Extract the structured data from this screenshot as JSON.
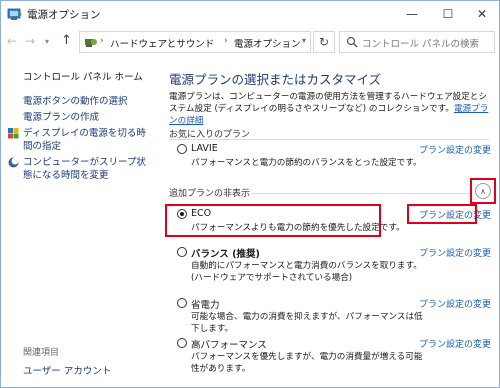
{
  "window": {
    "title": "電源オプション",
    "controls": {
      "minimize": "—",
      "maximize": "☐",
      "close": "✕"
    }
  },
  "nav": {
    "back": "←",
    "forward": "→",
    "dropdown": "▾",
    "up": "↑",
    "breadcrumb": [
      "ハードウェアとサウンド",
      "電源オプション"
    ],
    "separator": "›",
    "address_dropdown": "▾",
    "refresh": "↻",
    "search_placeholder": "コントロール パネルの検索"
  },
  "sidebar": {
    "home": "コントロール パネル ホーム",
    "links": [
      "電源ボタンの動作の選択",
      "電源プランの作成",
      "ディスプレイの電源を切る時間の指定",
      "コンピューターがスリープ状態になる時間を変更"
    ],
    "related_label": "関連項目",
    "user_accounts": "ユーザー アカウント"
  },
  "main": {
    "title": "電源プランの選択またはカスタマイズ",
    "description": "電源プランは、コンピューターの電源の使用方法を管理するハードウェア設定とシステム設定 (ディスプレイの明るさやスリープなど) のコレクションです。",
    "description_link": "電源プランの詳細",
    "favorites_label": "お気に入りのプラン",
    "hidden_label": "追加プランの非表示",
    "collapse_icon": "∧",
    "change_link": "プラン設定の変更",
    "plans": [
      {
        "name": "LAVIE",
        "desc": "パフォーマンスと電力の節約のバランスをとった設定です。",
        "selected": false,
        "bold": false
      },
      {
        "name": "ECO",
        "desc": "パフォーマンスよりも電力の節約を優先した設定です。",
        "selected": true,
        "bold": false
      },
      {
        "name": "バランス (推奨)",
        "desc": "自動的にパフォーマンスと電力消費のバランスを取ります。(ハードウェアでサポートされている場合)",
        "selected": false,
        "bold": true
      },
      {
        "name": "省電力",
        "desc": "可能な場合、電力の消費を抑えますが、パフォーマンスは低下します。",
        "selected": false,
        "bold": false
      },
      {
        "name": "高パフォーマンス",
        "desc": "パフォーマンスを優先しますが、電力の消費量が増える可能性があります。",
        "selected": false,
        "bold": false
      }
    ]
  },
  "colors": {
    "highlight": "#e0001b",
    "link": "#1a5fb4",
    "title": "#1e3a78"
  }
}
